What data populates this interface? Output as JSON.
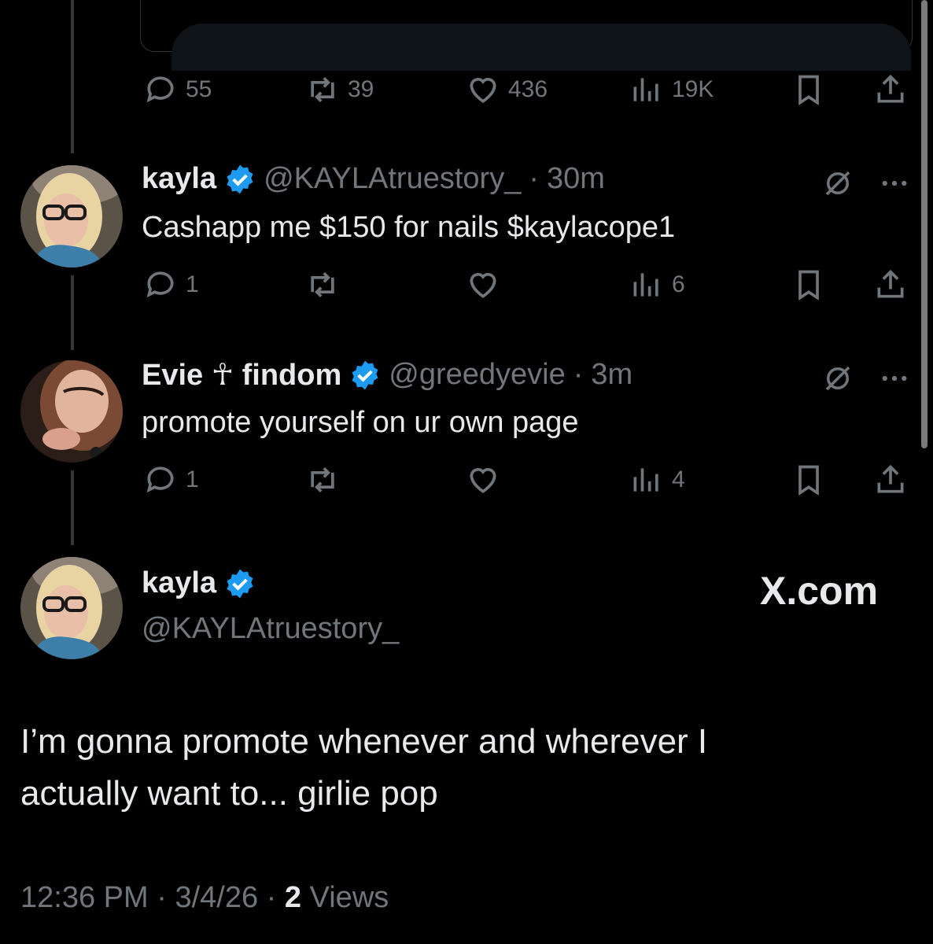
{
  "colors": {
    "background": "#000000",
    "text": "#e7e9ea",
    "muted": "#71767b",
    "verified": "#1d9bf0"
  },
  "top_post": {
    "replies": "55",
    "reposts": "39",
    "likes": "436",
    "views": "19K"
  },
  "reply1": {
    "name": "kayla",
    "handle": "@KAYLAtruestory_",
    "time": "30m",
    "text": "Cashapp me $150 for nails $kaylacope1",
    "replies": "1",
    "views": "6"
  },
  "reply2": {
    "name": "Evie ☥ findom",
    "handle": "@greedyevie",
    "time": "3m",
    "text": "promote yourself on ur own page",
    "replies": "1",
    "views": "4"
  },
  "main": {
    "name": "kayla",
    "handle": "@KAYLAtruestory_",
    "watermark": "X.com",
    "text_line1": "I’m gonna promote whenever and wherever I",
    "text_line2": "actually want to... girlie pop",
    "time": "12:36 PM",
    "date": "3/4/26",
    "views_count": "2",
    "views_label": "Views"
  }
}
